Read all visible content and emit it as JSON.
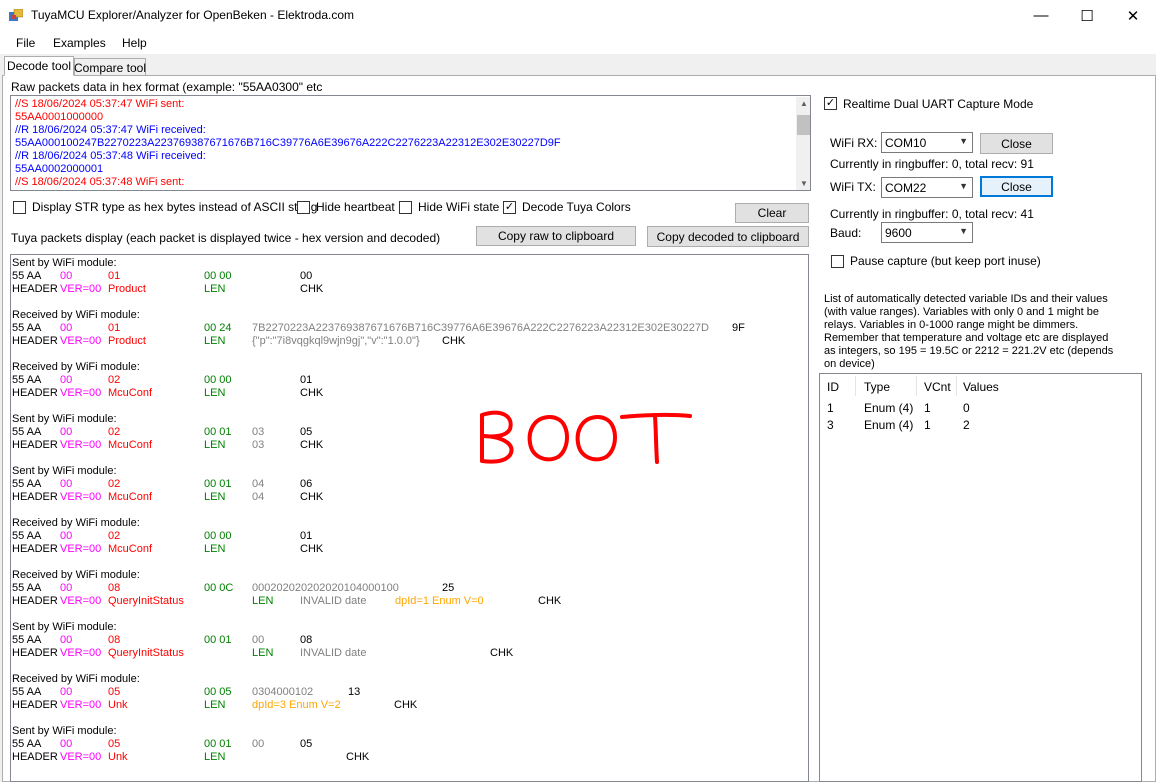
{
  "window": {
    "title": "TuyaMCU Explorer/Analyzer for OpenBeken - Elektroda.com",
    "minimize": "—",
    "maximize": "☐",
    "close": "✕"
  },
  "menu": [
    "File",
    "Examples",
    "Help"
  ],
  "tabs": [
    "Decode tool",
    "Compare tool"
  ],
  "raw": {
    "label": "Raw packets data in hex format (example: \"55AA0300\" etc",
    "lines": [
      {
        "text": "//S 18/06/2024 05:37:47 WiFi sent:",
        "color": "red"
      },
      {
        "text": "55AA0001000000",
        "color": "red"
      },
      {
        "text": "//R 18/06/2024 05:37:47 WiFi received:",
        "color": "blue"
      },
      {
        "text": "55AA000100247B2270223A223769387671676B716C39776A6E39676A222C2276223A22312E302E30227D9F",
        "color": "blue"
      },
      {
        "text": "//R 18/06/2024 05:37:48 WiFi received:",
        "color": "blue"
      },
      {
        "text": "55AA0002000001",
        "color": "blue"
      },
      {
        "text": "//S 18/06/2024 05:37:48 WiFi sent:",
        "color": "red"
      }
    ]
  },
  "options": {
    "str_hex": "Display STR type as hex bytes instead of ASCII string",
    "hide_heartbeat": "Hide heartbeat",
    "hide_wifi_state": "Hide WiFi state",
    "decode_colors": "Decode Tuya Colors",
    "decode_colors_checked": "✓",
    "clear": "Clear"
  },
  "display": {
    "label": "Tuya packets display (each packet is displayed twice - hex version and decoded)",
    "copy_raw": "Copy raw to clipboard",
    "copy_decoded": "Copy decoded to clipboard"
  },
  "packets": [
    {
      "title": "Sent by WiFi module:",
      "h1": "55 AA",
      "v1": "00",
      "c1": "01",
      "l1": "00 00",
      "g1": "",
      "k1": "00",
      "h2": "HEADER",
      "v2": "VER=00",
      "c2": "Product",
      "l2": "LEN",
      "g2": "",
      "k2": "CHK"
    },
    {
      "title": "Received by WiFi module:",
      "h1": "55 AA",
      "v1": "00",
      "c1": "01",
      "l1": "00 24",
      "g1": "7B2270223A223769387671676B716C39776A6E39676A222C2276223A22312E302E30227D",
      "k1": "9F",
      "h2": "HEADER",
      "v2": "VER=00",
      "c2": "Product",
      "l2": "LEN",
      "g2": "{\"p\":\"7i8vqgkql9wjn9gj\",\"v\":\"1.0.0\"}",
      "k2": "CHK"
    },
    {
      "title": "Received by WiFi module:",
      "h1": "55 AA",
      "v1": "00",
      "c1": "02",
      "l1": "00 00",
      "g1": "",
      "k1": "01",
      "h2": "HEADER",
      "v2": "VER=00",
      "c2": "McuConf",
      "l2": "LEN",
      "g2": "",
      "k2": "CHK"
    },
    {
      "title": "Sent by WiFi module:",
      "h1": "55 AA",
      "v1": "00",
      "c1": "02",
      "l1": "00 01",
      "g1": "03",
      "k1": "05",
      "h2": "HEADER",
      "v2": "VER=00",
      "c2": "McuConf",
      "l2": "LEN",
      "g2": "03",
      "k2": "CHK"
    },
    {
      "title": "Sent by WiFi module:",
      "h1": "55 AA",
      "v1": "00",
      "c1": "02",
      "l1": "00 01",
      "g1": "04",
      "k1": "06",
      "h2": "HEADER",
      "v2": "VER=00",
      "c2": "McuConf",
      "l2": "LEN",
      "g2": "04",
      "k2": "CHK"
    },
    {
      "title": "Received by WiFi module:",
      "h1": "55 AA",
      "v1": "00",
      "c1": "02",
      "l1": "00 00",
      "g1": "",
      "k1": "01",
      "h2": "HEADER",
      "v2": "VER=00",
      "c2": "McuConf",
      "l2": "LEN",
      "g2": "",
      "k2": "CHK"
    },
    {
      "title": "Received by WiFi module:",
      "h1": "55 AA",
      "v1": "00",
      "c1": "08",
      "l1": "00 0C",
      "g1": "000202020202020104000100",
      "k1": "25",
      "h2": "HEADER",
      "v2": "VER=00",
      "c2": "QueryInitStatus",
      "l2": "LEN",
      "g2": "INVALID date",
      "o2": "dpId=1 Enum V=0",
      "k2": "CHK"
    },
    {
      "title": "Sent by WiFi module:",
      "h1": "55 AA",
      "v1": "00",
      "c1": "08",
      "l1": "00 01",
      "g1": "00",
      "k1": "08",
      "h2": "HEADER",
      "v2": "VER=00",
      "c2": "QueryInitStatus",
      "l2": "LEN",
      "g2": "INVALID date",
      "k2": "CHK"
    },
    {
      "title": "Received by WiFi module:",
      "h1": "55 AA",
      "v1": "00",
      "c1": "05",
      "l1": "00 05",
      "g1": "0304000102",
      "k1": "13",
      "h2": "HEADER",
      "v2": "VER=00",
      "c2": "Unk",
      "l2": "LEN",
      "g2": "",
      "o2": "dpId=3 Enum V=2",
      "k2": "CHK"
    },
    {
      "title": "Sent by WiFi module:",
      "h1": "55 AA",
      "v1": "00",
      "c1": "05",
      "l1": "00 01",
      "g1": "00",
      "k1": "05",
      "h2": "HEADER",
      "v2": "VER=00",
      "c2": "Unk",
      "l2": "LEN",
      "g2": "",
      "k2": "CHK"
    }
  ],
  "annotation": {
    "text": "BOOT",
    "color": "#ff0000"
  },
  "capture": {
    "realtime": "Realtime Dual UART Capture Mode",
    "realtime_checked": "✓",
    "wifi_rx_label": "WiFi RX:",
    "wifi_rx_port": "COM10",
    "rx_close": "Close",
    "rx_status": "Currently in ringbuffer: 0, total recv: 91",
    "wifi_tx_label": "WiFi TX:",
    "wifi_tx_port": "COM22",
    "tx_close": "Close",
    "tx_status": "Currently in ringbuffer: 0, total recv: 41",
    "baud_label": "Baud:",
    "baud": "9600",
    "pause": "Pause capture (but keep port inuse)"
  },
  "variables": {
    "description": [
      "List of automatically detected variable IDs  and their values",
      "(with value ranges). Variables with only 0 and 1 might be",
      "relays. Variables in 0-1000 range might be dimmers.",
      "Remember that temperature and voltage etc are displayed",
      "as integers, so 195 = 19.5C or 2212 = 221.2V etc (depends",
      "on device)"
    ],
    "columns": [
      "ID",
      "Type",
      "VCnt",
      "Values"
    ],
    "rows": [
      [
        "1",
        "Enum (4)",
        "1",
        "0"
      ],
      [
        "3",
        "Enum (4)",
        "1",
        "2"
      ]
    ]
  }
}
